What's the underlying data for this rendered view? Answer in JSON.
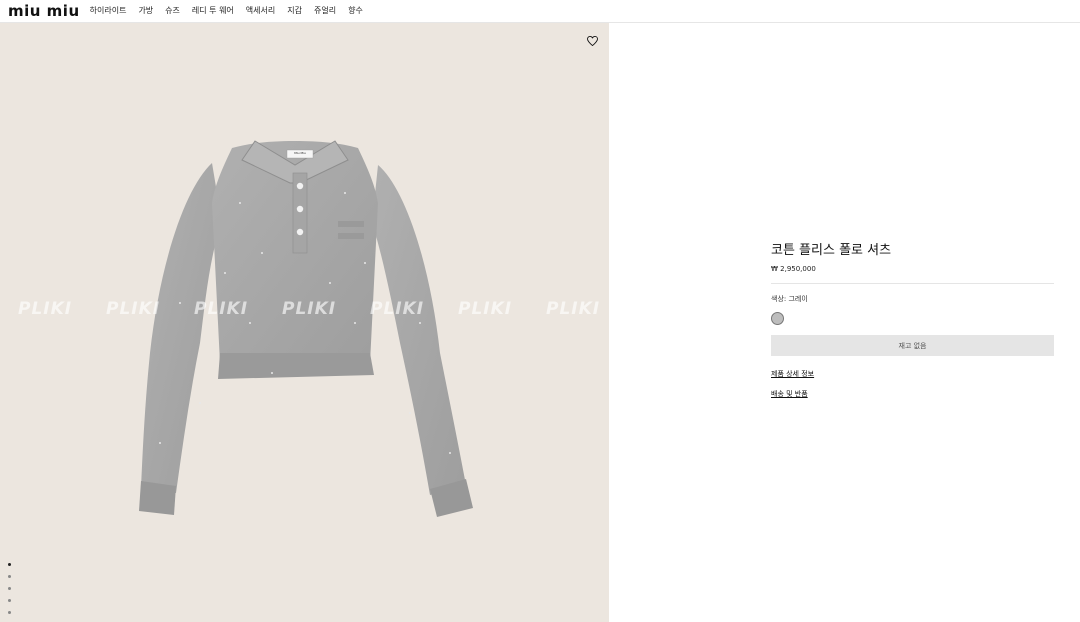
{
  "header": {
    "logo": "miu miu",
    "nav": [
      "하이라이트",
      "가방",
      "슈즈",
      "레디 투 웨어",
      "액세서리",
      "지갑",
      "쥬얼리",
      "향수"
    ]
  },
  "product_image": {
    "label_text": "Miu Miu",
    "watermark": "PLIKI",
    "wishlist_icon": "heart-icon",
    "gallery_count": 5,
    "gallery_active_index": 0
  },
  "product": {
    "title": "코튼 플리스 폴로 셔츠",
    "price": "₩ 2,950,000",
    "color_label": "색상:",
    "color_value": "그레이",
    "swatch_color": "#bdbdbd",
    "out_of_stock_label": "재고 없음",
    "details_link": "제품 상세 정보",
    "shipping_link": "배송 및 반품"
  },
  "colors": {
    "image_background": "#ece6df",
    "shirt": "#a8a8a8"
  }
}
